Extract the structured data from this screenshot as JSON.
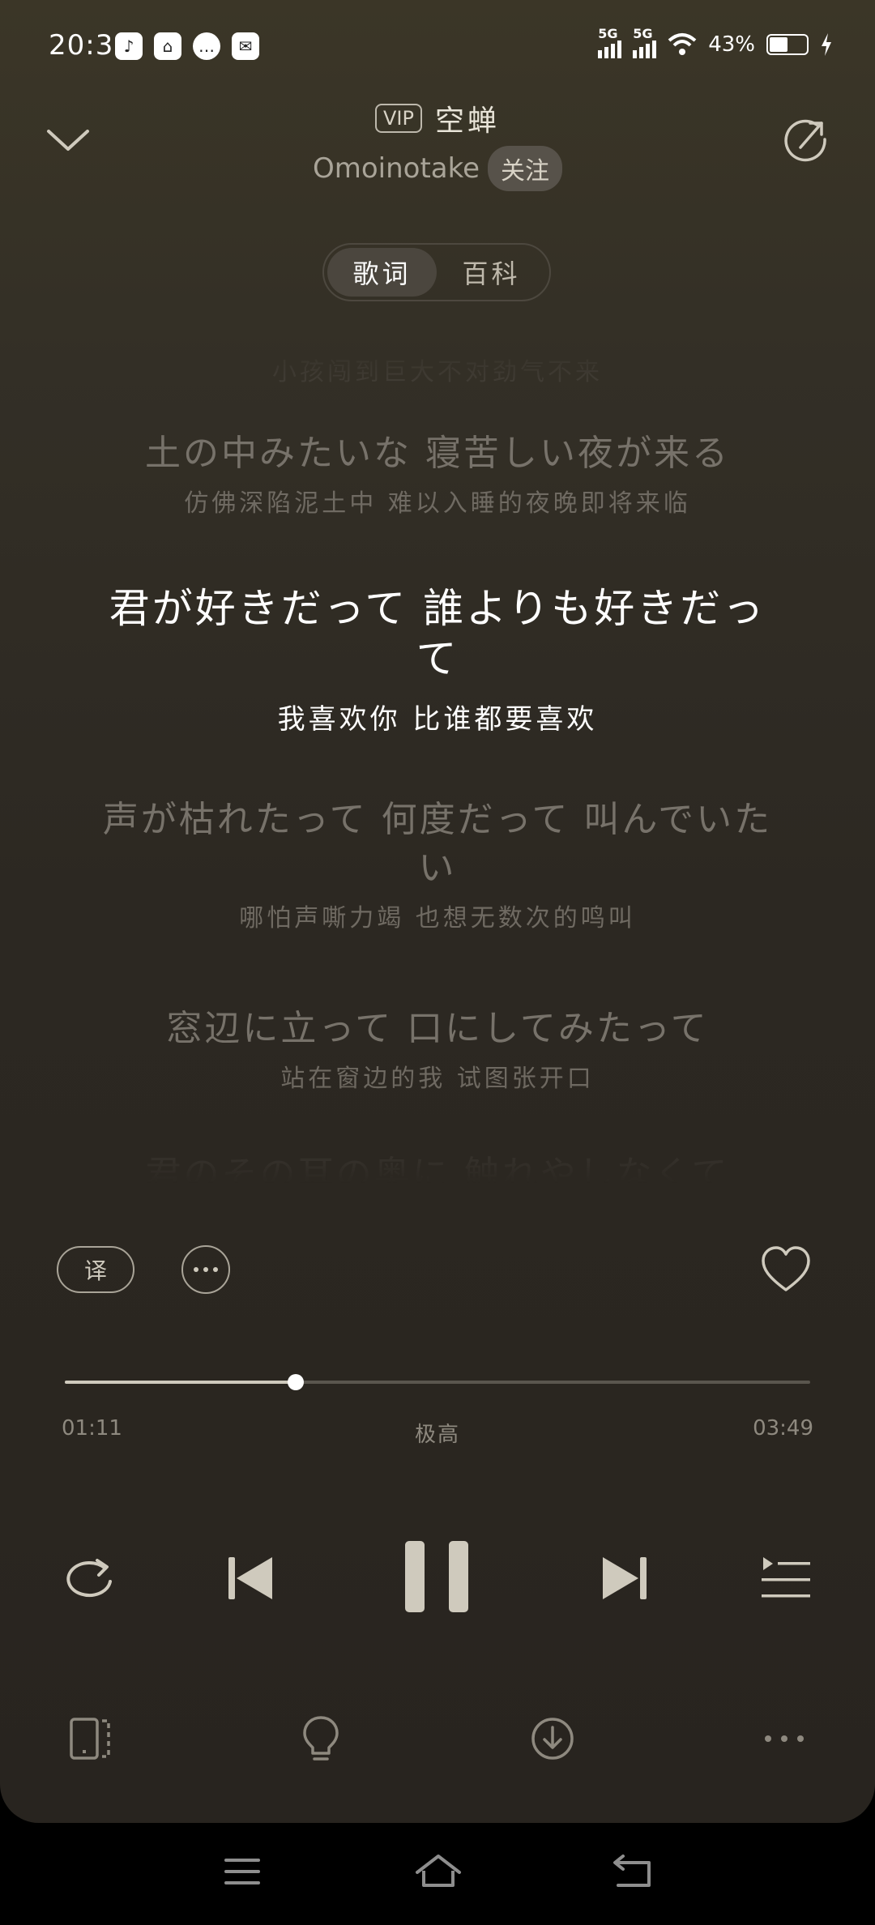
{
  "status_bar": {
    "time": "20:36",
    "net1": "5G",
    "net2": "5G",
    "battery": "43%"
  },
  "header": {
    "vip_badge": "VIP",
    "song_title": "空蝉",
    "artist": "Omoinotake",
    "follow_label": "关注"
  },
  "tabs": [
    {
      "label": "歌词",
      "active": true
    },
    {
      "label": "百科",
      "active": false
    }
  ],
  "lyrics": [
    {
      "jp": "",
      "cn": "小孩闯到巨大不对劲气不来"
    },
    {
      "jp": "土の中みたいな 寝苦しい夜が来る",
      "cn": "仿佛深陷泥土中 难以入睡的夜晚即将来临"
    },
    {
      "jp": "君が好きだって 誰よりも好きだって",
      "cn": "我喜欢你 比谁都要喜欢"
    },
    {
      "jp": "声が枯れたって 何度だって 叫んでいたい",
      "cn": "哪怕声嘶力竭 也想无数次的鸣叫"
    },
    {
      "jp": "窓辺に立って 口にしてみたって",
      "cn": "站在窗边的我 试图张开口"
    },
    {
      "jp": "君のその耳の奥に 触れやしなくて",
      "cn": ""
    }
  ],
  "actions": {
    "translate_label": "译"
  },
  "playback": {
    "current_time": "01:11",
    "total_time": "03:49",
    "progress": 0.31,
    "quality": "极高"
  },
  "colors": {
    "background_top": "#3b3627",
    "background_bottom": "#28241f",
    "lyric_active": "#ffffff",
    "lyric_inactive": "#77726a"
  }
}
